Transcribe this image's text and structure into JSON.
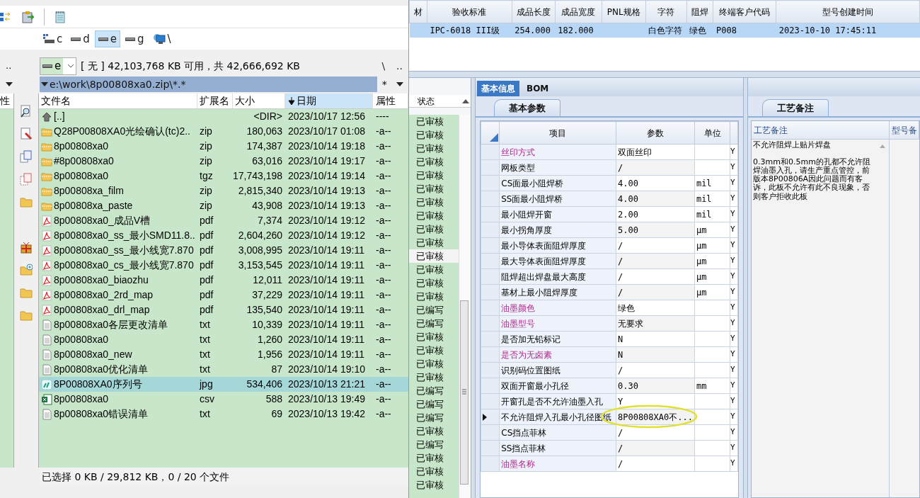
{
  "drives": [
    {
      "label": "c",
      "kind": "system",
      "selected": false
    },
    {
      "label": "d",
      "kind": "disk",
      "selected": false
    },
    {
      "label": "e",
      "kind": "disk",
      "selected": true
    },
    {
      "label": "g",
      "kind": "disk",
      "selected": false
    },
    {
      "label": "\\",
      "kind": "network",
      "selected": false
    }
  ],
  "left_pane": {
    "up_button": "..",
    "header": "性"
  },
  "drive_combo": {
    "value": "e"
  },
  "free_space": "[ 无 ] 42,103,768 KB 可用，共 42,666,692 KB",
  "root_button": "\\",
  "up_button": "..",
  "path": "e:\\work\\8p00808xa0.zip\\*.*",
  "filter": "*",
  "file_list": {
    "columns": [
      {
        "label": "文件名",
        "sorted": false
      },
      {
        "label": "扩展名",
        "sorted": false
      },
      {
        "label": "大小",
        "sorted": false
      },
      {
        "label": "日期",
        "sorted": true
      },
      {
        "label": "属性",
        "sorted": false
      }
    ],
    "rows": [
      {
        "kind": "up",
        "name": "[..]",
        "size": "<DIR>",
        "date": "2023/10/17 12:56",
        "attr": "----",
        "selected": false
      },
      {
        "kind": "zip",
        "name": "Q28P00808XA0光绘确认(tc)2..",
        "ext": "zip",
        "size": "180,063",
        "date": "2023/10/17 01:08",
        "attr": "-a--",
        "selected": false
      },
      {
        "kind": "zip",
        "name": "8p00808xa0",
        "ext": "zip",
        "size": "174,387",
        "date": "2023/10/14 19:18",
        "attr": "-a--",
        "selected": false
      },
      {
        "kind": "zip",
        "name": "#8p00808xa0",
        "ext": "zip",
        "size": "63,016",
        "date": "2023/10/14 19:17",
        "attr": "-a--",
        "selected": false
      },
      {
        "kind": "zip",
        "name": "8p00808xa0",
        "ext": "tgz",
        "size": "17,743,198",
        "date": "2023/10/14 19:14",
        "attr": "-a--",
        "selected": false
      },
      {
        "kind": "zip",
        "name": "8p00808xa_film",
        "ext": "zip",
        "size": "2,815,340",
        "date": "2023/10/14 19:13",
        "attr": "-a--",
        "selected": false
      },
      {
        "kind": "zip",
        "name": "8p00808xa_paste",
        "ext": "zip",
        "size": "43,908",
        "date": "2023/10/14 19:13",
        "attr": "-a--",
        "selected": false
      },
      {
        "kind": "pdf",
        "name": "8p00808xa0_成品V槽",
        "ext": "pdf",
        "size": "7,374",
        "date": "2023/10/14 19:12",
        "attr": "-a--",
        "selected": false
      },
      {
        "kind": "pdf",
        "name": "8p00808xa0_ss_最小SMD11.8..",
        "ext": "pdf",
        "size": "2,604,260",
        "date": "2023/10/14 19:12",
        "attr": "-a--",
        "selected": false
      },
      {
        "kind": "pdf",
        "name": "8p00808xa0_ss_最小线宽7.870",
        "ext": "pdf",
        "size": "3,008,995",
        "date": "2023/10/14 19:11",
        "attr": "-a--",
        "selected": false
      },
      {
        "kind": "pdf",
        "name": "8p00808xa0_cs_最小线宽7.870",
        "ext": "pdf",
        "size": "3,153,545",
        "date": "2023/10/14 19:11",
        "attr": "-a--",
        "selected": false
      },
      {
        "kind": "pdf",
        "name": "8p00808xa0_biaozhu",
        "ext": "pdf",
        "size": "12,011",
        "date": "2023/10/14 19:11",
        "attr": "-a--",
        "selected": false
      },
      {
        "kind": "pdf",
        "name": "8p00808xa0_2rd_map",
        "ext": "pdf",
        "size": "37,229",
        "date": "2023/10/14 19:11",
        "attr": "-a--",
        "selected": false
      },
      {
        "kind": "pdf",
        "name": "8p00808xa0_drl_map",
        "ext": "pdf",
        "size": "135,540",
        "date": "2023/10/14 19:11",
        "attr": "-a--",
        "selected": false
      },
      {
        "kind": "txt",
        "name": "8p00808xa0各层更改清单",
        "ext": "txt",
        "size": "10,339",
        "date": "2023/10/14 19:11",
        "attr": "-a--",
        "selected": false
      },
      {
        "kind": "txt",
        "name": "8p00808xa0",
        "ext": "txt",
        "size": "1,260",
        "date": "2023/10/14 19:11",
        "attr": "-a--",
        "selected": false
      },
      {
        "kind": "txt",
        "name": "8p00808xa0_new",
        "ext": "txt",
        "size": "1,956",
        "date": "2023/10/14 19:11",
        "attr": "-a--",
        "selected": false
      },
      {
        "kind": "txt",
        "name": "8p00808xa0优化清单",
        "ext": "txt",
        "size": "87",
        "date": "2023/10/14 19:10",
        "attr": "-a--",
        "selected": false
      },
      {
        "kind": "jpg",
        "name": "8P00808XA0序列号",
        "ext": "jpg",
        "size": "534,406",
        "date": "2023/10/13 21:21",
        "attr": "-a--",
        "selected": true
      },
      {
        "kind": "csv",
        "name": "8p00808xa0",
        "ext": "csv",
        "size": "588",
        "date": "2023/10/13 19:49",
        "attr": "-a--",
        "selected": false
      },
      {
        "kind": "txt",
        "name": "8p00808xa0错误清单",
        "ext": "txt",
        "size": "69",
        "date": "2023/10/13 19:42",
        "attr": "-a--",
        "selected": false
      }
    ]
  },
  "status_bar": "已选择 0 KB / 29,812 KB，0 / 20 个文件",
  "model_table": {
    "columns": [
      "材",
      "验收标准",
      "成品长度",
      "成品宽度",
      "PNL规格",
      "字符",
      "阻焊",
      "终端客户代码",
      "型号创建时间"
    ],
    "rows": [
      {
        "selected": true,
        "cells": [
          null,
          "IPC-6018 III级",
          "254.000",
          "182.000",
          null,
          "白色字符",
          "绿色",
          "P008",
          "2023-10-10 17:45:11"
        ]
      }
    ]
  },
  "status_column": {
    "header": "状态",
    "rows": [
      {
        "text": "已审核",
        "selected": false
      },
      {
        "text": "已审核",
        "selected": false
      },
      {
        "text": "已审核",
        "selected": false
      },
      {
        "text": "已审核",
        "selected": false
      },
      {
        "text": "已审核",
        "selected": false
      },
      {
        "text": "已审核",
        "selected": false
      },
      {
        "text": "已审核",
        "selected": false
      },
      {
        "text": "已审核",
        "selected": false
      },
      {
        "text": "已审核",
        "selected": false
      },
      {
        "text": "已审核",
        "selected": false
      },
      {
        "text": "已审核",
        "selected": true
      },
      {
        "text": "已审核",
        "selected": false
      },
      {
        "text": "已审核",
        "selected": false
      },
      {
        "text": "已审核",
        "selected": false
      },
      {
        "text": "已编写",
        "selected": false
      },
      {
        "text": "已编写",
        "selected": false
      },
      {
        "text": "已审核",
        "selected": false
      },
      {
        "text": "已审核",
        "selected": false
      },
      {
        "text": "已审核",
        "selected": false
      },
      {
        "text": "已审核",
        "selected": false
      },
      {
        "text": "已编写",
        "selected": false
      },
      {
        "text": "已编写",
        "selected": false
      },
      {
        "text": "已编写",
        "selected": false
      },
      {
        "text": "已审核",
        "selected": false
      },
      {
        "text": "已编写",
        "selected": false
      },
      {
        "text": "已审核",
        "selected": false
      },
      {
        "text": "已审核",
        "selected": false
      },
      {
        "text": "已审核",
        "selected": false
      }
    ]
  },
  "detail_panel": {
    "tabs": [
      {
        "label": "基本信息",
        "selected": true
      },
      {
        "label": "BOM",
        "selected": false
      }
    ],
    "subtab": {
      "label": "基本参数",
      "selected": true
    },
    "columns": [
      "项目",
      "参数",
      "单位"
    ],
    "rows": [
      {
        "item": "丝印方式",
        "param": "双面丝印",
        "flag": "Y",
        "highlighted": true,
        "current": false,
        "circled": false
      },
      {
        "item": "网板类型",
        "param": "/",
        "flag": "Y",
        "highlighted": false,
        "current": false,
        "circled": false
      },
      {
        "item": "CS面最小阻焊桥",
        "param": "4.00",
        "unit": "mil",
        "flag": "Y",
        "highlighted": false,
        "current": false,
        "circled": false
      },
      {
        "item": "SS面最小阻焊桥",
        "param": "4.00",
        "unit": "mil",
        "flag": "Y",
        "highlighted": false,
        "current": false,
        "circled": false
      },
      {
        "item": "最小阻焊开窗",
        "param": "2.00",
        "unit": "mil",
        "flag": "Y",
        "highlighted": false,
        "current": false,
        "circled": false
      },
      {
        "item": "最小拐角厚度",
        "param": "5.00",
        "unit": "μm",
        "flag": "Y",
        "highlighted": false,
        "current": false,
        "circled": false
      },
      {
        "item": "最小导体表面阻焊厚度",
        "param": "/",
        "unit": "μm",
        "flag": "Y",
        "highlighted": false,
        "current": false,
        "circled": false
      },
      {
        "item": "最大导体表面阻焊厚度",
        "param": "/",
        "unit": "μm",
        "flag": "Y",
        "highlighted": false,
        "current": false,
        "circled": false
      },
      {
        "item": "阻焊超出焊盘最大高度",
        "param": "/",
        "unit": "μm",
        "flag": "Y",
        "highlighted": false,
        "current": false,
        "circled": false
      },
      {
        "item": "基材上最小阻焊厚度",
        "param": "/",
        "unit": "μm",
        "flag": "Y",
        "highlighted": false,
        "current": false,
        "circled": false
      },
      {
        "item": "油墨颜色",
        "param": "绿色",
        "flag": "Y",
        "highlighted": true,
        "current": false,
        "circled": false
      },
      {
        "item": "油墨型号",
        "param": "无要求",
        "flag": "Y",
        "highlighted": true,
        "current": false,
        "circled": false
      },
      {
        "item": "是否加无铅标记",
        "param": "N",
        "flag": "Y",
        "highlighted": false,
        "current": false,
        "circled": false
      },
      {
        "item": "是否为无卤素",
        "param": "N",
        "flag": "Y",
        "highlighted": true,
        "current": false,
        "circled": false
      },
      {
        "item": "识别码位置图纸",
        "param": "/",
        "flag": "Y",
        "highlighted": false,
        "current": false,
        "circled": false
      },
      {
        "item": "双面开窗最小孔径",
        "param": "0.30",
        "unit": "mm",
        "flag": "Y",
        "highlighted": false,
        "current": false,
        "circled": false
      },
      {
        "item": "开窗孔是否不允许油墨入孔",
        "param": "Y",
        "flag": "Y",
        "highlighted": false,
        "current": false,
        "circled": false
      },
      {
        "item": "不允许阻焊入孔最小孔径图纸",
        "param": "8P00808XA0不...",
        "flag": "Y",
        "highlighted": false,
        "current": true,
        "circled": true
      },
      {
        "item": "CS挡点菲林",
        "param": "/",
        "flag": "Y",
        "highlighted": false,
        "current": false,
        "circled": false
      },
      {
        "item": "SS挡点菲林",
        "param": "/",
        "flag": "Y",
        "highlighted": false,
        "current": false,
        "circled": false
      },
      {
        "item": "油墨名称",
        "param": "/",
        "flag": "Y",
        "highlighted": true,
        "current": false,
        "circled": false
      }
    ]
  },
  "notes_panel": {
    "tab": "工艺备注",
    "columns": [
      "工艺备注",
      "型号备"
    ],
    "note": "不允许阻焊上贴片焊盘\n\n0.3mm和0.5mm的孔都不允许阻焊油墨入孔，请生产重点管控，前版本8P00806A因此问题而有客诉，此板不允许有此不良现象，否则客户拒收此板"
  }
}
